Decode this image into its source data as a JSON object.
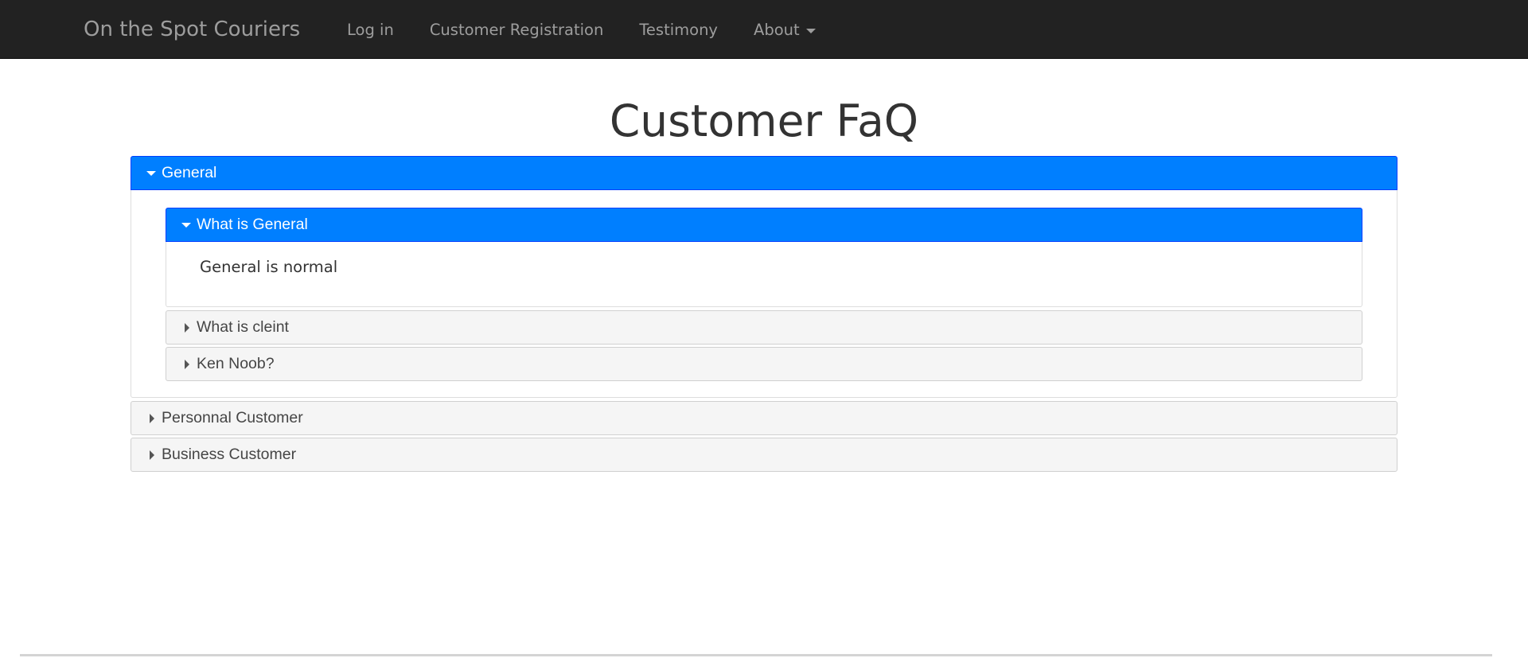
{
  "navbar": {
    "brand": "On the Spot Couriers",
    "links": [
      "Log in",
      "Customer Registration",
      "Testimony"
    ],
    "about_label": "About"
  },
  "page": {
    "title": "Customer FaQ"
  },
  "accordion": {
    "sections": [
      {
        "title": "General",
        "expanded": true,
        "items": [
          {
            "question": "What is General",
            "answer": "General is normal",
            "expanded": true
          },
          {
            "question": "What is cleint",
            "expanded": false
          },
          {
            "question": "Ken Noob?",
            "expanded": false
          }
        ]
      },
      {
        "title": "Personnal Customer",
        "expanded": false
      },
      {
        "title": "Business Customer",
        "expanded": false
      }
    ]
  },
  "colors": {
    "navbar_bg": "#222222",
    "active_header_bg": "#007fff",
    "inactive_header_bg": "#f5f5f5"
  },
  "icons": {
    "expanded": "triangle-down-icon",
    "collapsed": "triangle-right-icon",
    "dropdown": "caret-down-icon"
  }
}
